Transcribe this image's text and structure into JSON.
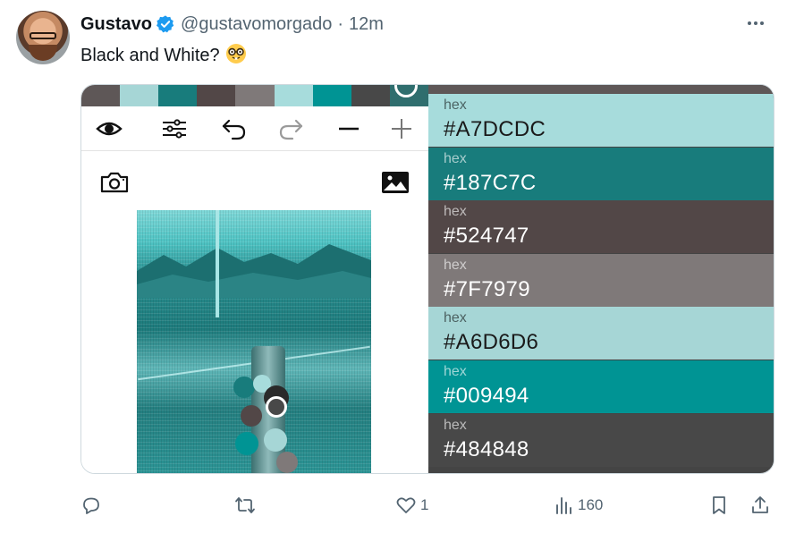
{
  "tweet": {
    "author_name": "Gustavo",
    "handle": "@gustavomorgado",
    "separator": "·",
    "time": "12m",
    "text": "Black and White?",
    "emoji": "nerd-face-emoji"
  },
  "media": {
    "left_strip_colors": [
      "#5e5757",
      "#a6d6d6",
      "#187c7c",
      "#524747",
      "#7f7979",
      "#a7dcdc",
      "#009494",
      "#484848",
      "#2f6e6e"
    ],
    "toolbar_icons": [
      "eye-icon",
      "sliders-icon",
      "undo-icon",
      "redo-icon",
      "minus-icon",
      "plus-icon"
    ],
    "palette": [
      {
        "label": "hex",
        "value": "#A7DCDC",
        "bg": "#a7dcdc",
        "fg": "#1a1a1a"
      },
      {
        "label": "hex",
        "value": "#187C7C",
        "bg": "#187c7c",
        "fg": "#ffffff"
      },
      {
        "label": "hex",
        "value": "#524747",
        "bg": "#524747",
        "fg": "#ffffff"
      },
      {
        "label": "hex",
        "value": "#7F7979",
        "bg": "#7f7979",
        "fg": "#ffffff"
      },
      {
        "label": "hex",
        "value": "#A6D6D6",
        "bg": "#a6d6d6",
        "fg": "#1a1a1a"
      },
      {
        "label": "hex",
        "value": "#009494",
        "bg": "#009494",
        "fg": "#ffffff"
      },
      {
        "label": "hex",
        "value": "#484848",
        "bg": "#484848",
        "fg": "#ffffff"
      }
    ]
  },
  "actions": {
    "reply_count": "",
    "retweet_count": "",
    "like_count": "1",
    "views_count": "160"
  },
  "colors": {
    "verified": "#1d9bf0",
    "muted": "#536471"
  }
}
